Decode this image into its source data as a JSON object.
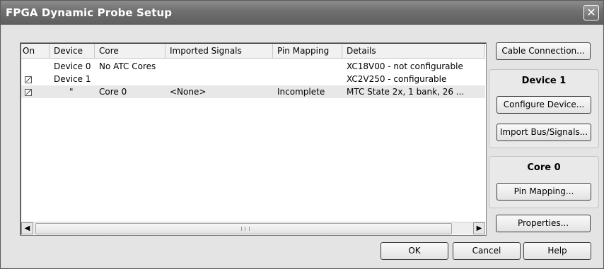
{
  "window": {
    "title": "FPGA Dynamic Probe Setup",
    "close_glyph": "✕"
  },
  "list": {
    "columns": [
      "On",
      "Device",
      "Core",
      "Imported Signals",
      "Pin Mapping",
      "Details"
    ],
    "rows": [
      {
        "on": "",
        "device": "Device 0",
        "core": "No ATC Cores",
        "imported": "",
        "pin": "",
        "details": "XC18V00 - not configurable",
        "checkbox": false
      },
      {
        "on": "",
        "device": "Device 1",
        "core": "",
        "imported": "",
        "pin": "",
        "details": "XC2V250 - configurable",
        "checkbox": true
      },
      {
        "on": "",
        "device": "\"",
        "core": "Core 0",
        "imported": "<None>",
        "pin": "Incomplete",
        "details": "MTC State 2x, 1 bank, 26 ...",
        "checkbox": true
      }
    ]
  },
  "side": {
    "cable_button": "Cable Connection...",
    "device_group": {
      "title": "Device 1",
      "configure_button": "Configure Device...",
      "import_button": "Import Bus/Signals..."
    },
    "core_group": {
      "title": "Core 0",
      "pin_mapping_button": "Pin Mapping..."
    },
    "properties_button": "Properties..."
  },
  "footer": {
    "ok_button": "OK",
    "cancel_button": "Cancel",
    "help_button": "Help"
  },
  "icons": {
    "scroll_left": "scroll-left-icon",
    "scroll_right": "scroll-right-icon",
    "close": "close-icon"
  }
}
